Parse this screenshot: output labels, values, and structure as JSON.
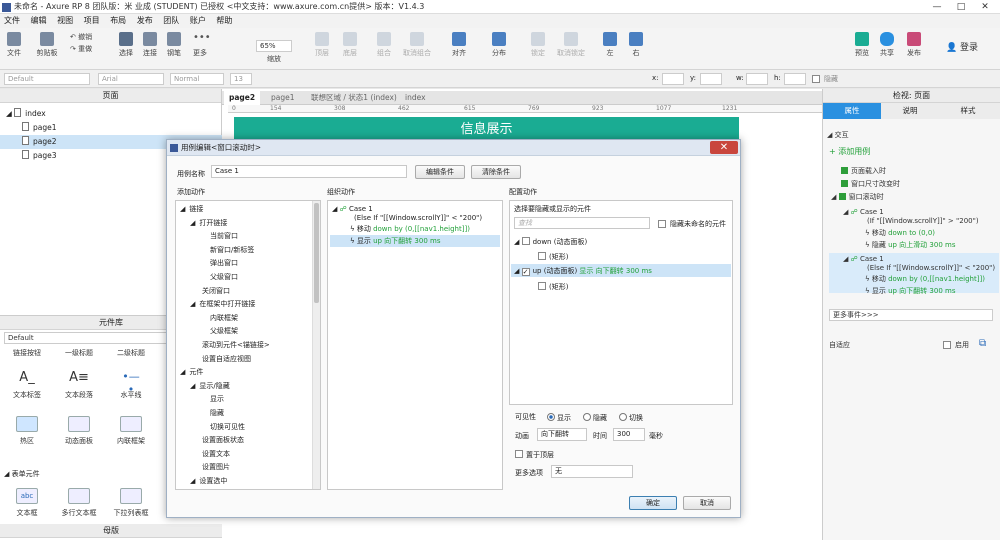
{
  "window": {
    "title": "未命名 - Axure RP 8 团队版：米 业成 (STUDENT) 已授权 <中文支持：www.axure.com.cn提供> 版本：V1.4.3",
    "controls": [
      "—",
      "□",
      "✕"
    ]
  },
  "menu": [
    "文件",
    "编辑",
    "视图",
    "项目",
    "布局",
    "发布",
    "团队",
    "账户",
    "帮助"
  ],
  "toolbar": {
    "file": "文件",
    "clipboard": "剪贴板",
    "undo": "撤销",
    "redo": "重做",
    "select": "选择",
    "connect": "连接",
    "pen": "钢笔",
    "more": "更多",
    "zoom_value": "65%",
    "zoom_label": "缩放",
    "top": "顶层",
    "bottom": "底层",
    "group": "组合",
    "ungroup": "取消组合",
    "align": "对齐",
    "distribute": "分布",
    "lock": "锁定",
    "unlock": "取消锁定",
    "left": "左",
    "right": "右",
    "preview": "预览",
    "share": "共享",
    "publish": "发布",
    "login": "登录"
  },
  "format": {
    "style": "Default",
    "font": "Arial",
    "weight": "Normal",
    "size": "13",
    "x": "x:",
    "y": "y:",
    "w": "w:",
    "h": "h:",
    "hidden": "隐藏"
  },
  "pages_panel": {
    "title": "页面",
    "items": [
      "index",
      "page1",
      "page2",
      "page3"
    ]
  },
  "library_panel": {
    "title": "元件库",
    "select": "Default",
    "row0": [
      "链接按钮",
      "一级标题",
      "二级标题"
    ],
    "row1": [
      "文本标签",
      "文本段落",
      "水平线"
    ],
    "row2": [
      "热区",
      "动态面板",
      "内联框架"
    ],
    "section": "表单元件",
    "row3": [
      "文本框",
      "多行文本框",
      "下拉列表框"
    ]
  },
  "master_panel": {
    "title": "母版"
  },
  "tabs": [
    "page2",
    "page1",
    "联想区域 / 状态1 (index)",
    "index"
  ],
  "ruler": [
    "0",
    "154",
    "308",
    "462",
    "615",
    "769",
    "923",
    "1077",
    "1231"
  ],
  "banner": "信息展示",
  "inspector": {
    "title": "检视: 页面",
    "tabs": [
      "属性",
      "说明",
      "样式"
    ],
    "interaction": "交互",
    "add_case": "添加用例",
    "events": [
      "页面载入时",
      "窗口尺寸改变时",
      "窗口滚动时"
    ],
    "case1": {
      "name": "Case 1",
      "cond": "(If \"[[Window.scrollY]]\" > \"200\")",
      "a1": "移动",
      "a1v": "down to (0,0)",
      "a2": "隐藏",
      "a2v": "up 向上滑动 300 ms"
    },
    "case2": {
      "name": "Case 1",
      "cond": "(Else If \"[[Window.scrollY]]\" < \"200\")",
      "a1": "移动",
      "a1v": "down by (0,[[nav1.height]])",
      "a2": "显示",
      "a2v": "up 向下翻转 300 ms"
    },
    "more_events": "更多事件>>>",
    "adaptive": "自适应",
    "enable": "启用"
  },
  "dialog": {
    "title": "用例编辑<窗口滚动时>",
    "case_label": "用例名称",
    "case_name": "Case 1",
    "edit_cond": "编辑条件",
    "clear_cond": "清除条件",
    "add_action": "添加动作",
    "org_action": "组织动作",
    "config_action": "配置动作",
    "actions": [
      {
        "t": "链接",
        "lvl": 0,
        "arrow": "◢"
      },
      {
        "t": "打开链接",
        "lvl": 1,
        "arrow": "◢"
      },
      {
        "t": "当前窗口",
        "lvl": 3
      },
      {
        "t": "新窗口/新标签",
        "lvl": 3
      },
      {
        "t": "弹出窗口",
        "lvl": 3
      },
      {
        "t": "父级窗口",
        "lvl": 3
      },
      {
        "t": "关闭窗口",
        "lvl": 2
      },
      {
        "t": "在框架中打开链接",
        "lvl": 1,
        "arrow": "◢"
      },
      {
        "t": "内联框架",
        "lvl": 3
      },
      {
        "t": "父级框架",
        "lvl": 3
      },
      {
        "t": "滚动到元件<锚链接>",
        "lvl": 2
      },
      {
        "t": "设置自适应视图",
        "lvl": 2
      },
      {
        "t": "元件",
        "lvl": 0,
        "arrow": "◢"
      },
      {
        "t": "显示/隐藏",
        "lvl": 1,
        "arrow": "◢"
      },
      {
        "t": "显示",
        "lvl": 3
      },
      {
        "t": "隐藏",
        "lvl": 3
      },
      {
        "t": "切换可见性",
        "lvl": 3
      },
      {
        "t": "设置面板状态",
        "lvl": 2
      },
      {
        "t": "设置文本",
        "lvl": 2
      },
      {
        "t": "设置图片",
        "lvl": 2
      },
      {
        "t": "设置选中",
        "lvl": 1,
        "arrow": "◢"
      }
    ],
    "org": {
      "case": "Case 1",
      "cond": "(Else If \"[[Window.scrollY]]\" < \"200\")",
      "a1": "移动",
      "a1v": "down by (0,[[nav1.height]])",
      "a2": "显示",
      "a2v": "up 向下翻转 300 ms"
    },
    "config": {
      "prompt": "选择要隐藏或显示的元件",
      "search_placeholder": "查找",
      "hide_unnamed": "隐藏未命名的元件",
      "items": [
        {
          "t": "down (动态面板)",
          "checked": false,
          "lvl": 0
        },
        {
          "t": "(矩形)",
          "checked": false,
          "lvl": 1
        },
        {
          "t": "up (动态面板)",
          "extra": "显示 向下翻转 300 ms",
          "checked": true,
          "lvl": 0
        },
        {
          "t": "(矩形)",
          "checked": false,
          "lvl": 1
        }
      ],
      "visibility": "可见性",
      "show": "显示",
      "hide": "隐藏",
      "toggle": "切换",
      "anim_label": "动画",
      "anim_value": "向下翻转",
      "time_label": "时间",
      "time_value": "300",
      "ms": "毫秒",
      "bring_top": "置于顶层",
      "more_opts": "更多选项",
      "more_value": "无"
    },
    "ok": "确定",
    "cancel": "取消"
  },
  "colors": {
    "accent": "#1aac93",
    "action_green": "#23a13a",
    "tab_blue": "#2a90e0"
  }
}
